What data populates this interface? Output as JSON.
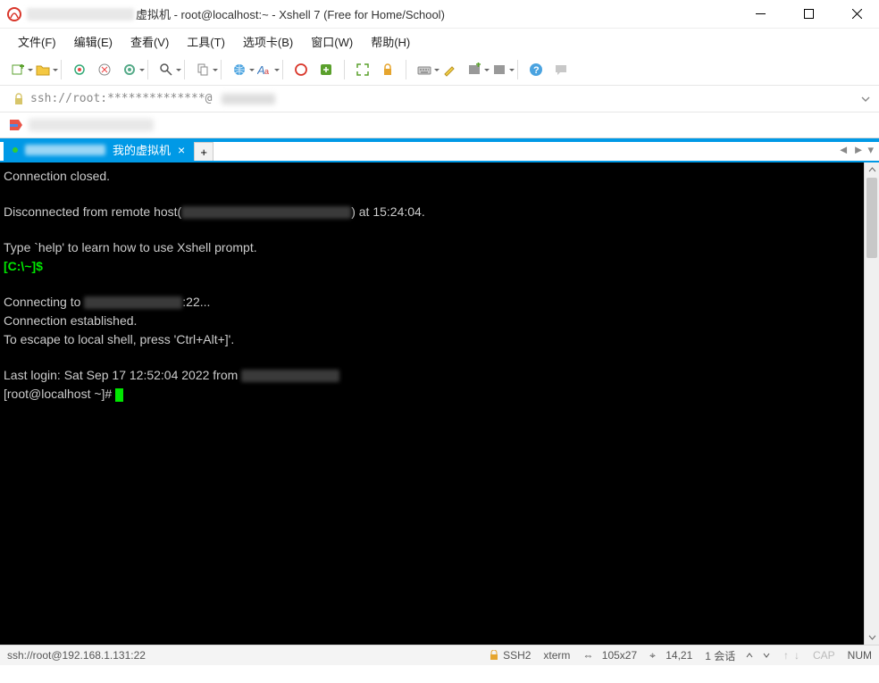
{
  "title": {
    "suffix": "虚拟机 - root@localhost:~ - Xshell 7 (Free for Home/School)"
  },
  "menu": [
    "文件(F)",
    "编辑(E)",
    "查看(V)",
    "工具(T)",
    "选项卡(B)",
    "窗口(W)",
    "帮助(H)"
  ],
  "address": {
    "url": "ssh://root:**************@"
  },
  "tab": {
    "label_suffix": "我的虚拟机"
  },
  "terminal": {
    "l1": "Connection closed.",
    "l2a": "Disconnected from remote host(",
    "l2b": ") at 15:24:04.",
    "l3": "Type `help' to learn how to use Xshell prompt.",
    "prompt1": "[C:\\~]$",
    "l4a": "Connecting to ",
    "l4b": ":22...",
    "l5": "Connection established.",
    "l6": "To escape to local shell, press 'Ctrl+Alt+]'.",
    "l7a": "Last login: Sat Sep 17 12:52:04 2022 from ",
    "prompt2": "[root@localhost ~]# "
  },
  "status": {
    "conn": "ssh://root@192.168.1.131:22",
    "proto": "SSH2",
    "term": "xterm",
    "size": "105x27",
    "pos": "14,21",
    "sessions": "1 会话",
    "cap": "CAP",
    "num": "NUM"
  }
}
